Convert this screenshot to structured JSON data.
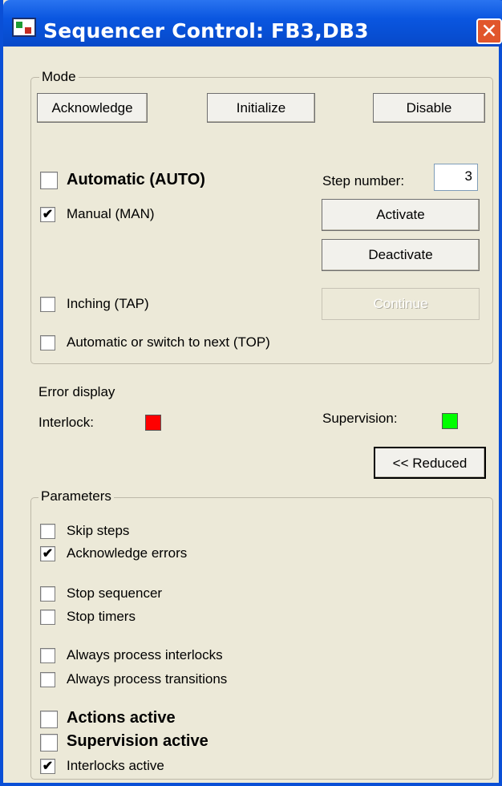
{
  "window": {
    "title": "Sequencer Control: FB3,DB3",
    "close_glyph": "✕"
  },
  "mode": {
    "legend": "Mode",
    "acknowledge_label": "Acknowledge",
    "initialize_label": "Initialize",
    "disable_label": "Disable",
    "automatic_label": "Automatic (AUTO)",
    "automatic_checked": false,
    "manual_label": "Manual (MAN)",
    "manual_checked": true,
    "inching_label": "Inching (TAP)",
    "inching_checked": false,
    "top_label": "Automatic or switch to next (TOP)",
    "top_checked": false,
    "step_number_label": "Step number:",
    "step_number_value": "3",
    "activate_label": "Activate",
    "deactivate_label": "Deactivate",
    "continue_label": "Continue",
    "continue_enabled": false
  },
  "errors": {
    "title": "Error display",
    "interlock_label": "Interlock:",
    "interlock_color": "#ff0000",
    "supervision_label": "Supervision:",
    "supervision_color": "#00ff00",
    "reduced_label": "<< Reduced"
  },
  "parameters": {
    "legend": "Parameters",
    "items": [
      {
        "label": "Skip steps",
        "checked": false,
        "bold": false
      },
      {
        "label": "Acknowledge errors",
        "checked": true,
        "bold": false
      },
      {
        "label": "Stop sequencer",
        "checked": false,
        "bold": false
      },
      {
        "label": "Stop timers",
        "checked": false,
        "bold": false
      },
      {
        "label": "Always process interlocks",
        "checked": false,
        "bold": false
      },
      {
        "label": "Always process transitions",
        "checked": false,
        "bold": false
      },
      {
        "label": "Actions active",
        "checked": false,
        "bold": true
      },
      {
        "label": "Supervision active",
        "checked": false,
        "bold": true
      },
      {
        "label": "Interlocks active",
        "checked": true,
        "bold": false
      }
    ]
  },
  "check_glyph": "✔"
}
